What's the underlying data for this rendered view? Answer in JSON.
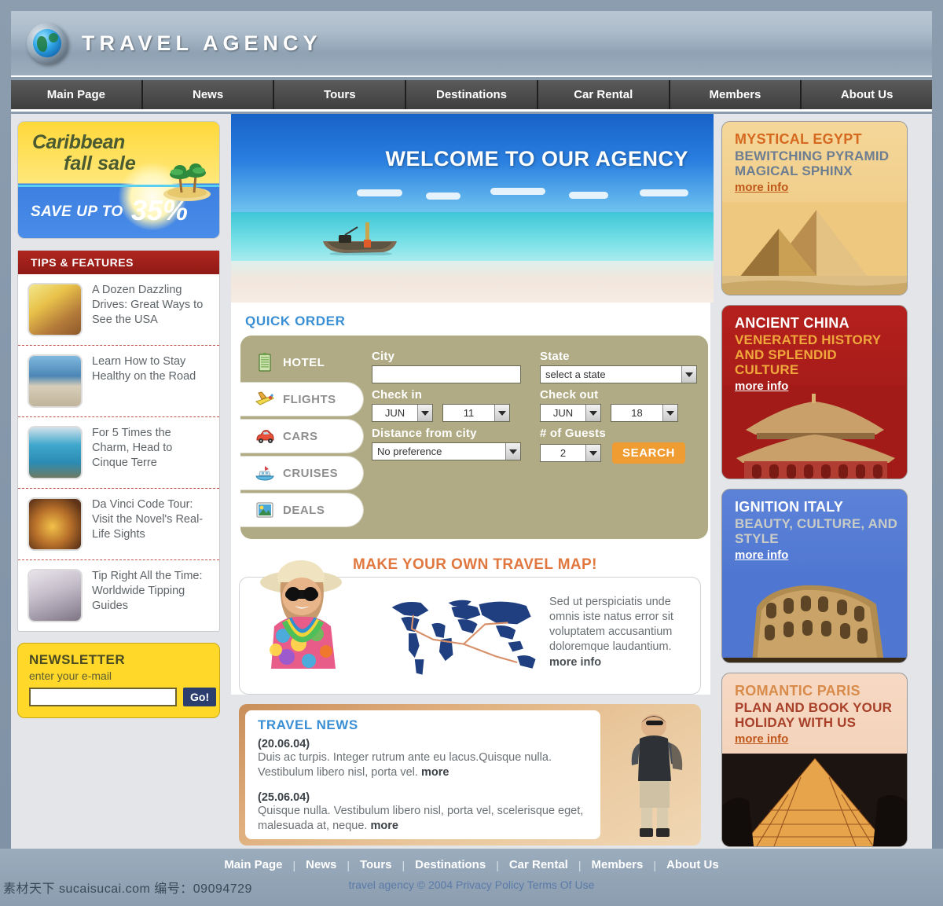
{
  "site": {
    "title": "TRAVEL AGENCY",
    "logo_icon": "globe-icon"
  },
  "nav": {
    "items": [
      {
        "label": "Main Page"
      },
      {
        "label": "News"
      },
      {
        "label": "Tours"
      },
      {
        "label": "Destinations"
      },
      {
        "label": "Car Rental"
      },
      {
        "label": "Members"
      },
      {
        "label": "About Us"
      }
    ]
  },
  "sale_banner": {
    "line1": "Caribbean",
    "line2": "fall sale",
    "line3": "SAVE UP TO",
    "line4": "35%",
    "palm_icon": "palm-tree-icon"
  },
  "tips": {
    "heading": "TIPS & FEATURES",
    "items": [
      {
        "text": "A Dozen Dazzling Drives: Great Ways to See the USA",
        "thumb": "desert-road-thumb"
      },
      {
        "text": "Learn How to Stay Healthy on the Road",
        "thumb": "beach-exercise-thumb"
      },
      {
        "text": "For 5 Times the Charm, Head to Cinque Terre",
        "thumb": "cinque-terre-thumb"
      },
      {
        "text": "Da Vinci Code Tour: Visit the Novel's Real-Life Sights",
        "thumb": "mona-lisa-thumb"
      },
      {
        "text": "Tip Right All the Time: Worldwide Tipping Guides",
        "thumb": "money-coins-thumb"
      }
    ]
  },
  "newsletter": {
    "title": "NEWSLETTER",
    "subtitle": "enter your e-mail",
    "input_value": "",
    "input_placeholder": "",
    "button_label": "Go!"
  },
  "hero": {
    "title": "WELCOME TO OUR AGENCY",
    "image": "tropical-beach-boat"
  },
  "quick_order": {
    "heading": "QUICK ORDER",
    "tabs": [
      {
        "label": "HOTEL",
        "icon": "hotel-icon",
        "active": true
      },
      {
        "label": "FLIGHTS",
        "icon": "airplane-icon",
        "active": false
      },
      {
        "label": "CARS",
        "icon": "car-icon",
        "active": false
      },
      {
        "label": "CRUISES",
        "icon": "cruise-ship-icon",
        "active": false
      },
      {
        "label": "DEALS",
        "icon": "deals-picture-icon",
        "active": false
      }
    ],
    "fields": {
      "city_label": "City",
      "city_value": "",
      "state_label": "State",
      "state_value": "select a state",
      "checkin_label": "Check in",
      "checkin_month": "JUN",
      "checkin_day": "11",
      "checkout_label": "Check out",
      "checkout_month": "JUN",
      "checkout_day": "18",
      "distance_label": "Distance from city",
      "distance_value": "No preference",
      "guests_label": "# of Guests",
      "guests_value": "2"
    },
    "search_label": "SEARCH"
  },
  "travel_map": {
    "title": "MAKE YOUR OWN TRAVEL MAP!",
    "body": "Sed ut perspiciatis unde omnis iste natus error sit voluptatem accusantium doloremque laudantium.",
    "more_label": "more info",
    "person_image": "smiling-tourist-photo",
    "map_image": "world-map-routes"
  },
  "travel_news": {
    "title": "TRAVEL NEWS",
    "hiker_image": "backpacker-photo",
    "entries": [
      {
        "date": "(20.06.04)",
        "body": "Duis ac turpis. Integer rutrum ante eu lacus.Quisque nulla. Vestibulum libero nisl, porta vel.",
        "more_label": "more"
      },
      {
        "date": "(25.06.04)",
        "body": "Quisque nulla. Vestibulum libero nisl, porta vel,  scelerisque eget, malesuada at, neque.",
        "more_label": "more"
      }
    ]
  },
  "promos": [
    {
      "heading": "MYSTICAL EGYPT",
      "subheading": "BEWITCHING PYRAMID MAGICAL SPHINX",
      "more_label": "more info",
      "image": "pyramids-photo",
      "bg_color": "#f0cd88"
    },
    {
      "heading": "ANCIENT CHINA",
      "subheading": "VENERATED HISTORY AND SPLENDID CULTURE",
      "more_label": "more info",
      "image": "forbidden-city-photo",
      "bg_color": "#a31b18"
    },
    {
      "heading": "IGNITION ITALY",
      "subheading": "BEAUTY, CULTURE, AND STYLE",
      "more_label": "more info",
      "image": "colosseum-photo",
      "bg_color": "#4f76d0"
    },
    {
      "heading": "ROMANTIC PARIS",
      "subheading": "PLAN AND BOOK YOUR HOLIDAY WITH US",
      "more_label": "more info",
      "image": "louvre-pyramid-photo",
      "bg_color": "#f3d1b8"
    }
  ],
  "footer": {
    "links": [
      {
        "label": "Main Page"
      },
      {
        "label": "News"
      },
      {
        "label": "Tours"
      },
      {
        "label": "Destinations"
      },
      {
        "label": "Car Rental"
      },
      {
        "label": "Members"
      },
      {
        "label": "About Us"
      }
    ],
    "separator": "|",
    "copyright": "travel agency  © 2004",
    "privacy_label": "Privacy Policy",
    "terms_label": "Terms Of Use"
  },
  "watermark": {
    "text": "素材天下 sucaisucai.com  编号：09094729"
  }
}
